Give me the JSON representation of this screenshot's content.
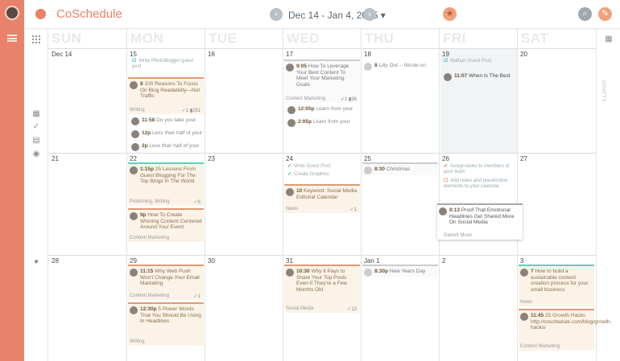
{
  "app": {
    "name": "CoSchedule",
    "date_range": "Dec 14 - Jan 4, 2015 ▾",
    "prev": "‹",
    "next": "›",
    "drafts_label": "DRAFTS"
  },
  "weekdays": [
    "SUN",
    "MON",
    "TUE",
    "WED",
    "THU",
    "FRI",
    "SAT"
  ],
  "week1": {
    "days": [
      "Dec 14",
      "15",
      "16",
      "17",
      "18",
      "19",
      "20"
    ],
    "mon_task": "Write Photoblogger guest post",
    "mon_card1": {
      "time": "8",
      "title": "100 Reasons To Focus On Blog Readability—Not Traffic",
      "foot": "Writing",
      "meta": "✓1 ▮251"
    },
    "mon_card2": {
      "time": "11:58",
      "title": "Do you take your"
    },
    "mon_card3": {
      "time": "12p",
      "title": "Less than half of your"
    },
    "mon_card4": {
      "time": "2p",
      "title": "Less than half of your"
    },
    "wed_card1": {
      "time": "9:05",
      "title": "How To Leverage Your Best Content To Meet Your Marketing Goals",
      "foot": "Content Marketing",
      "meta": "✓1 ▮96"
    },
    "wed_card2": {
      "time": "12:05p",
      "title": "Learn from your"
    },
    "wed_card3": {
      "time": "2:05p",
      "title": "Learn from your"
    },
    "thu_card": {
      "time": "8",
      "title": "Lilly Out -- Nicole on"
    },
    "fri_task": "Nathan Guest Post",
    "fri_card": {
      "time": "11:07",
      "title": "When Is The Best"
    }
  },
  "week2": {
    "days": [
      "21",
      "22",
      "23",
      "24",
      "25",
      "26",
      "27"
    ],
    "mon_card1": {
      "time": "1:15p",
      "title": "25 Lessons From Guest Blogging For The Top Blogs In The World",
      "foot": "Publishing, Writing",
      "meta": "✓6"
    },
    "mon_card2": {
      "time": "9p",
      "title": "How To Create Winning Content Centered Around Your Event",
      "foot": "Content Marketing"
    },
    "wed_task1": "Write Guest Post",
    "wed_task2": "Create Graphics",
    "wed_card": {
      "time": "10",
      "title": "Keyword: Social Media Editorial Calendar",
      "foot": "News",
      "meta": "✓1"
    },
    "thu_card": {
      "time": "8:30",
      "title": "Christmas"
    },
    "fri_task1": "Assign tasks to members of your team",
    "fri_task2": "Add notes and placeholder elements to your calendar",
    "popup": {
      "time": "9:13",
      "title": "Proof That Emotional Headlines Get Shared More On Social Media",
      "foot": "Garrett Moon"
    }
  },
  "week3": {
    "days": [
      "28",
      "29",
      "30",
      "31",
      "Jan 1",
      "2",
      "3"
    ],
    "mon_card1": {
      "time": "11:15",
      "title": "Why Web Push Won't Change Your Email Marketing",
      "foot": "Content Marketing",
      "meta": "✓1"
    },
    "mon_card2": {
      "time": "12:30p",
      "title": "5 Power Words That You Should Be Using In Headlines",
      "foot": "Writing"
    },
    "wed_card": {
      "time": "10:30",
      "title": "Why It Pays to Share Your Top Posts Even If They're a Few Months Old",
      "foot": "Social Media",
      "meta": "✓12"
    },
    "thu_card": {
      "time": "8:30p",
      "title": "New Years Day"
    },
    "sat_card1": {
      "time": "7",
      "title": "How to build a sustainable content creation process for your small business",
      "foot": "News"
    },
    "sat_card2": {
      "time": "11:45",
      "title": "25 Growth Hacks http://coschedule.com/blog/growth-hacks/",
      "foot": "Content Marketing"
    }
  }
}
